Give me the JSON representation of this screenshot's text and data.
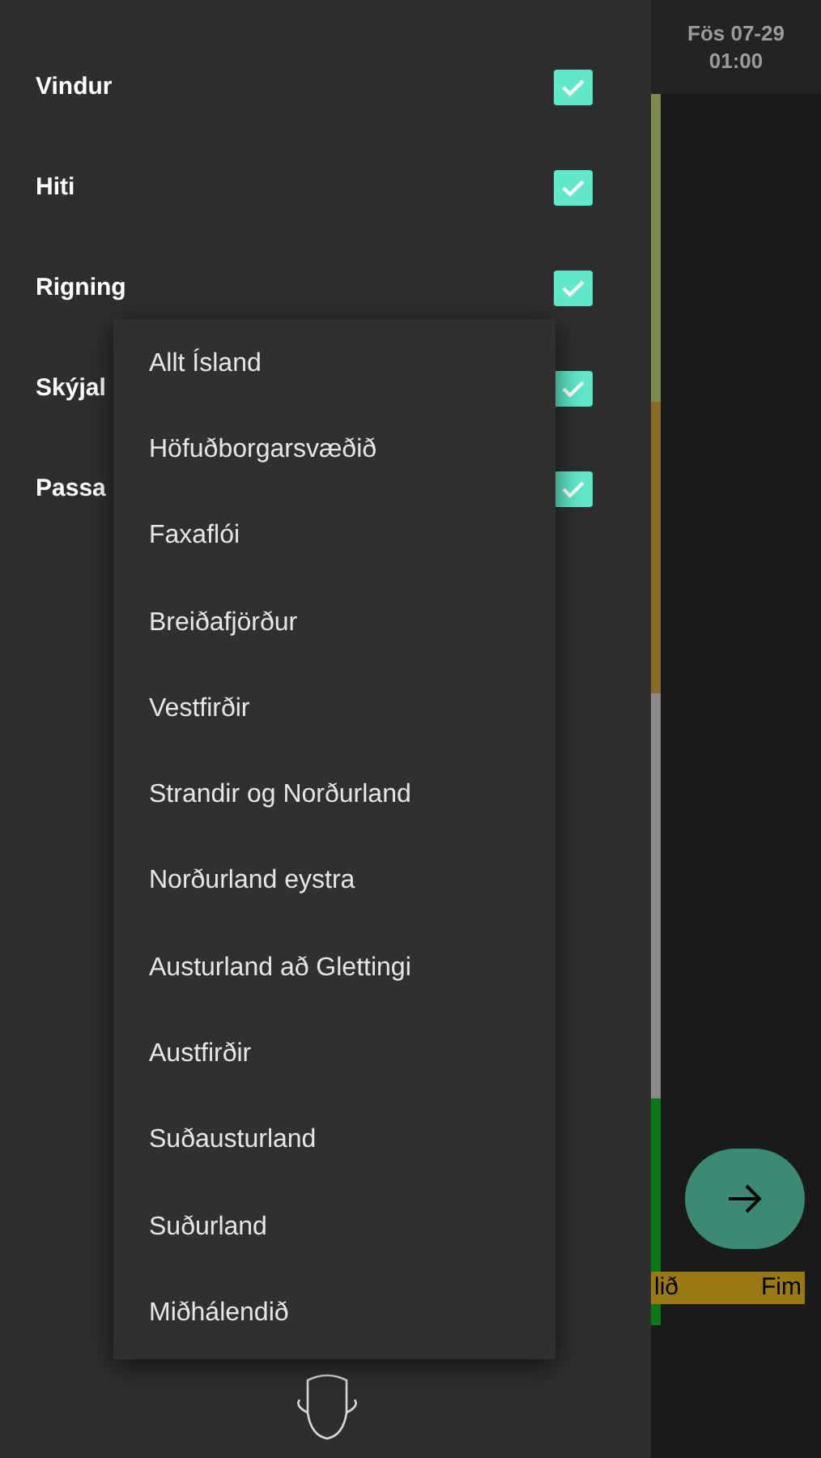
{
  "drawer": {
    "layers": [
      {
        "label": "Vindur",
        "checked": true
      },
      {
        "label": "Hiti",
        "checked": true
      },
      {
        "label": "Rigning",
        "checked": true
      },
      {
        "label": "Skýjal",
        "checked": true
      },
      {
        "label": "Passa",
        "checked": true
      }
    ]
  },
  "region_menu": {
    "items": [
      {
        "label": "Allt Ísland"
      },
      {
        "label": "Höfuðborgarsvæðið"
      },
      {
        "label": "Faxaflói"
      },
      {
        "label": "Breiðafjörður"
      },
      {
        "label": "Vestfirðir"
      },
      {
        "label": "Strandir og Norðurland"
      },
      {
        "label": "Norðurland eystra"
      },
      {
        "label": "Austurland að Glettingi"
      },
      {
        "label": "Austfirðir"
      },
      {
        "label": "Suðausturland"
      },
      {
        "label": "Suðurland"
      },
      {
        "label": "Miðhálendið"
      }
    ]
  },
  "header": {
    "date": "Fös 07-29",
    "time": "01:00"
  },
  "timeline": {
    "left": "lið",
    "right": "Fim"
  }
}
